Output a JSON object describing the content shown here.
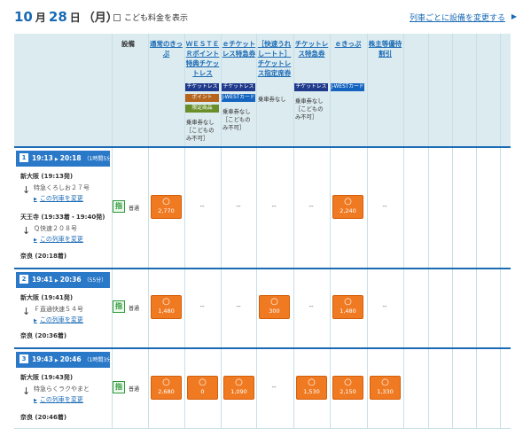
{
  "header": {
    "month": "10",
    "month_unit": "月",
    "day": "28",
    "day_unit": "日",
    "weekday": "（月）",
    "child_fare_label": "こども料金を表示",
    "change_equipment_link": "列車ごとに設備を変更する"
  },
  "table": {
    "equipment_header": "設備",
    "columns": [
      {
        "title": "通常のきっぷ",
        "tags": [],
        "note": ""
      },
      {
        "title": "ＷＥＳＴＥＲポイント特典チケットレス",
        "tags": [
          {
            "label": "チケットレス",
            "color": "navy"
          },
          {
            "label": "ポイント",
            "color": "brown"
          },
          {
            "label": "限定商品",
            "color": "green"
          }
        ],
        "note": "乗車券なし［こどものみ不可］"
      },
      {
        "title": "ｅチケットレス特急券",
        "tags": [
          {
            "label": "チケットレス",
            "color": "navy"
          },
          {
            "label": "J-WESTカード",
            "color": "blue"
          }
        ],
        "note": "乗車券なし［こどものみ不可］"
      },
      {
        "title": "［快速うれしートト］チケットレス指定席券",
        "tags": [],
        "note": "乗車券なし"
      },
      {
        "title": "チケットレス特急券",
        "tags": [
          {
            "label": "チケットレス",
            "color": "navy"
          }
        ],
        "note": "乗車券なし［こどものみ不可］"
      },
      {
        "title": "ｅきっぷ",
        "tags": [
          {
            "label": "J-WESTカード",
            "color": "blue"
          }
        ],
        "note": ""
      },
      {
        "title": "株主等優待割引",
        "tags": [],
        "note": ""
      }
    ]
  },
  "trains": [
    {
      "index": "1",
      "depart": "19:13",
      "arrive": "20:18",
      "duration": "（1時間5分）",
      "stops": [
        {
          "station": "新大阪 (19:13発)",
          "train": "特急くろしお２７号",
          "link": "この列車を変更"
        },
        {
          "station": "天王寺 (19:33着・19:40発)",
          "train": "Ｑ快速２０８号",
          "link": "この列車を変更"
        }
      ],
      "final": "奈良 (20:18着)",
      "seat_icon": "指",
      "seat_type": "普通",
      "fares": [
        {
          "mark": "○",
          "price": "2,770"
        },
        {
          "mark": "--"
        },
        {
          "mark": "--"
        },
        {
          "mark": "--"
        },
        {
          "mark": "--"
        },
        {
          "mark": "○",
          "price": "2,240"
        },
        {
          "mark": "--"
        }
      ]
    },
    {
      "index": "2",
      "depart": "19:41",
      "arrive": "20:36",
      "duration": "（55分）",
      "stops": [
        {
          "station": "新大阪 (19:41発)",
          "train": "Ｆ直通快速５４号",
          "link": "この列車を変更"
        }
      ],
      "final": "奈良 (20:36着)",
      "seat_icon": "指",
      "seat_type": "普通",
      "fares": [
        {
          "mark": "○",
          "price": "1,480"
        },
        {
          "mark": "--"
        },
        {
          "mark": "--"
        },
        {
          "mark": "○",
          "price": "300"
        },
        {
          "mark": "--"
        },
        {
          "mark": "○",
          "price": "1,480"
        },
        {
          "mark": "--"
        }
      ]
    },
    {
      "index": "3",
      "depart": "19:43",
      "arrive": "20:46",
      "duration": "（1時間3分）",
      "stops": [
        {
          "station": "新大阪 (19:43発)",
          "train": "特急らくラクやまと",
          "link": "この列車を変更"
        }
      ],
      "final": "奈良 (20:46着)",
      "seat_icon": "指",
      "seat_type": "普通",
      "fares": [
        {
          "mark": "○",
          "price": "2,680"
        },
        {
          "mark": "○",
          "price": "0"
        },
        {
          "mark": "○",
          "price": "1,090"
        },
        {
          "mark": "--"
        },
        {
          "mark": "○",
          "price": "1,530"
        },
        {
          "mark": "○",
          "price": "2,150"
        },
        {
          "mark": "○",
          "price": "1,330"
        }
      ]
    }
  ],
  "colors": {
    "accent": "#1a6ab4",
    "fare_button": "#f07a22",
    "header_bg": "#dcebf0",
    "seat_icon": "#2e9a3a"
  }
}
